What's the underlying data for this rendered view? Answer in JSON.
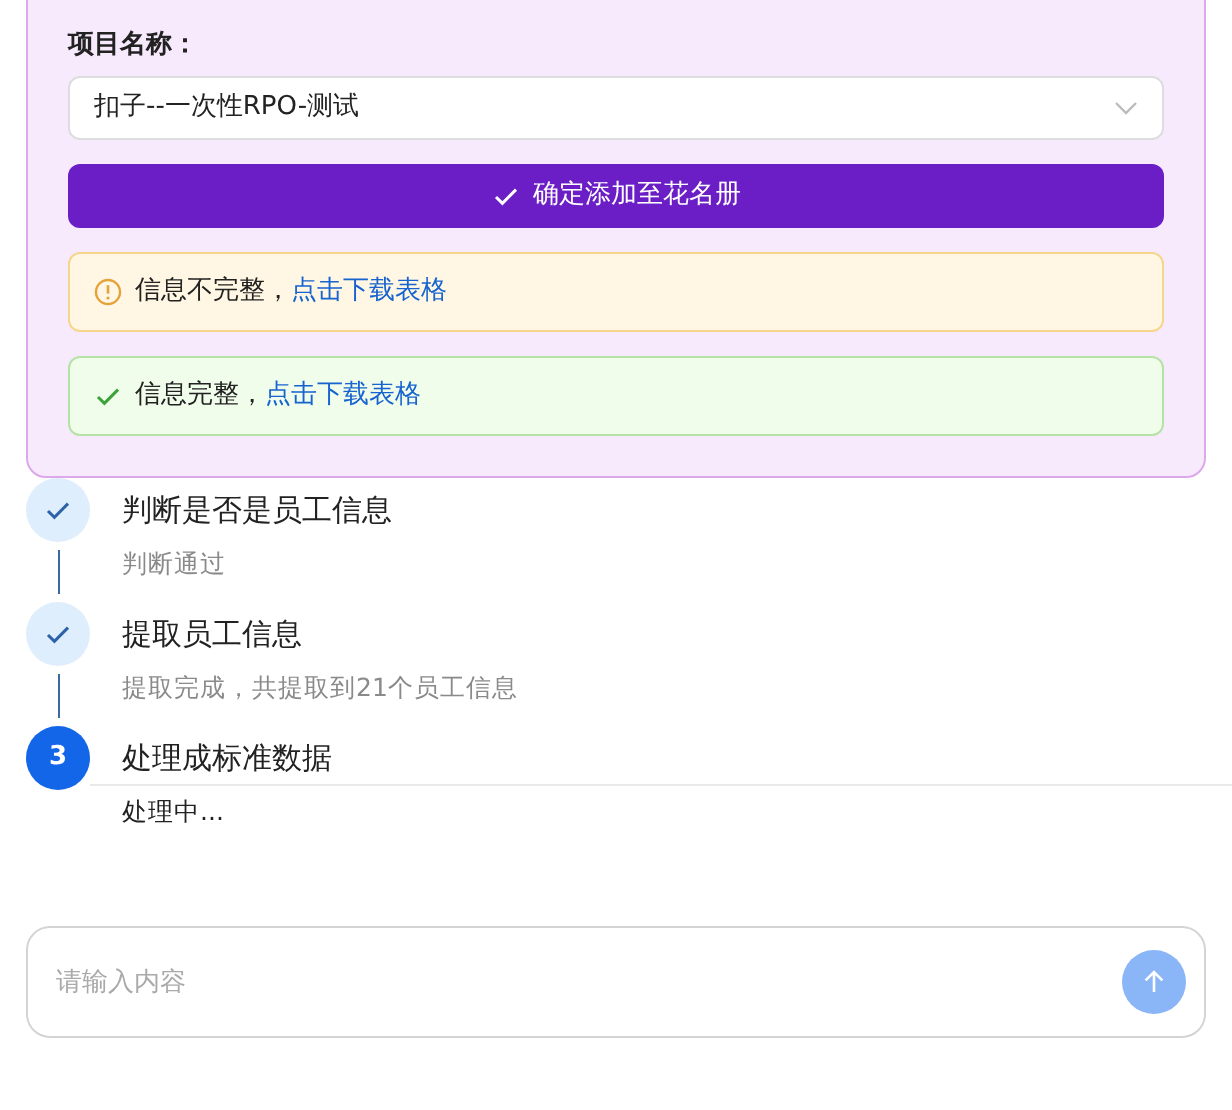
{
  "form": {
    "project_label": "项目名称：",
    "project_select": {
      "value": "扣子--一次性RPO-测试"
    },
    "confirm_button": "确定添加至花名册"
  },
  "alerts": [
    {
      "kind": "warning",
      "text": "信息不完整，",
      "link": "点击下载表格"
    },
    {
      "kind": "success",
      "text": "信息完整，",
      "link": "点击下载表格"
    }
  ],
  "steps": [
    {
      "completed": true,
      "title": "判断是否是员工信息",
      "description": "判断通过"
    },
    {
      "completed": true,
      "title": "提取员工信息",
      "description": "提取完成，共提取到21个员工信息"
    },
    {
      "completed": false,
      "number": "3",
      "title": "处理成标准数据",
      "description": "处理中..."
    }
  ],
  "chat_input": {
    "placeholder": "请输入内容",
    "send_disabled": true
  }
}
